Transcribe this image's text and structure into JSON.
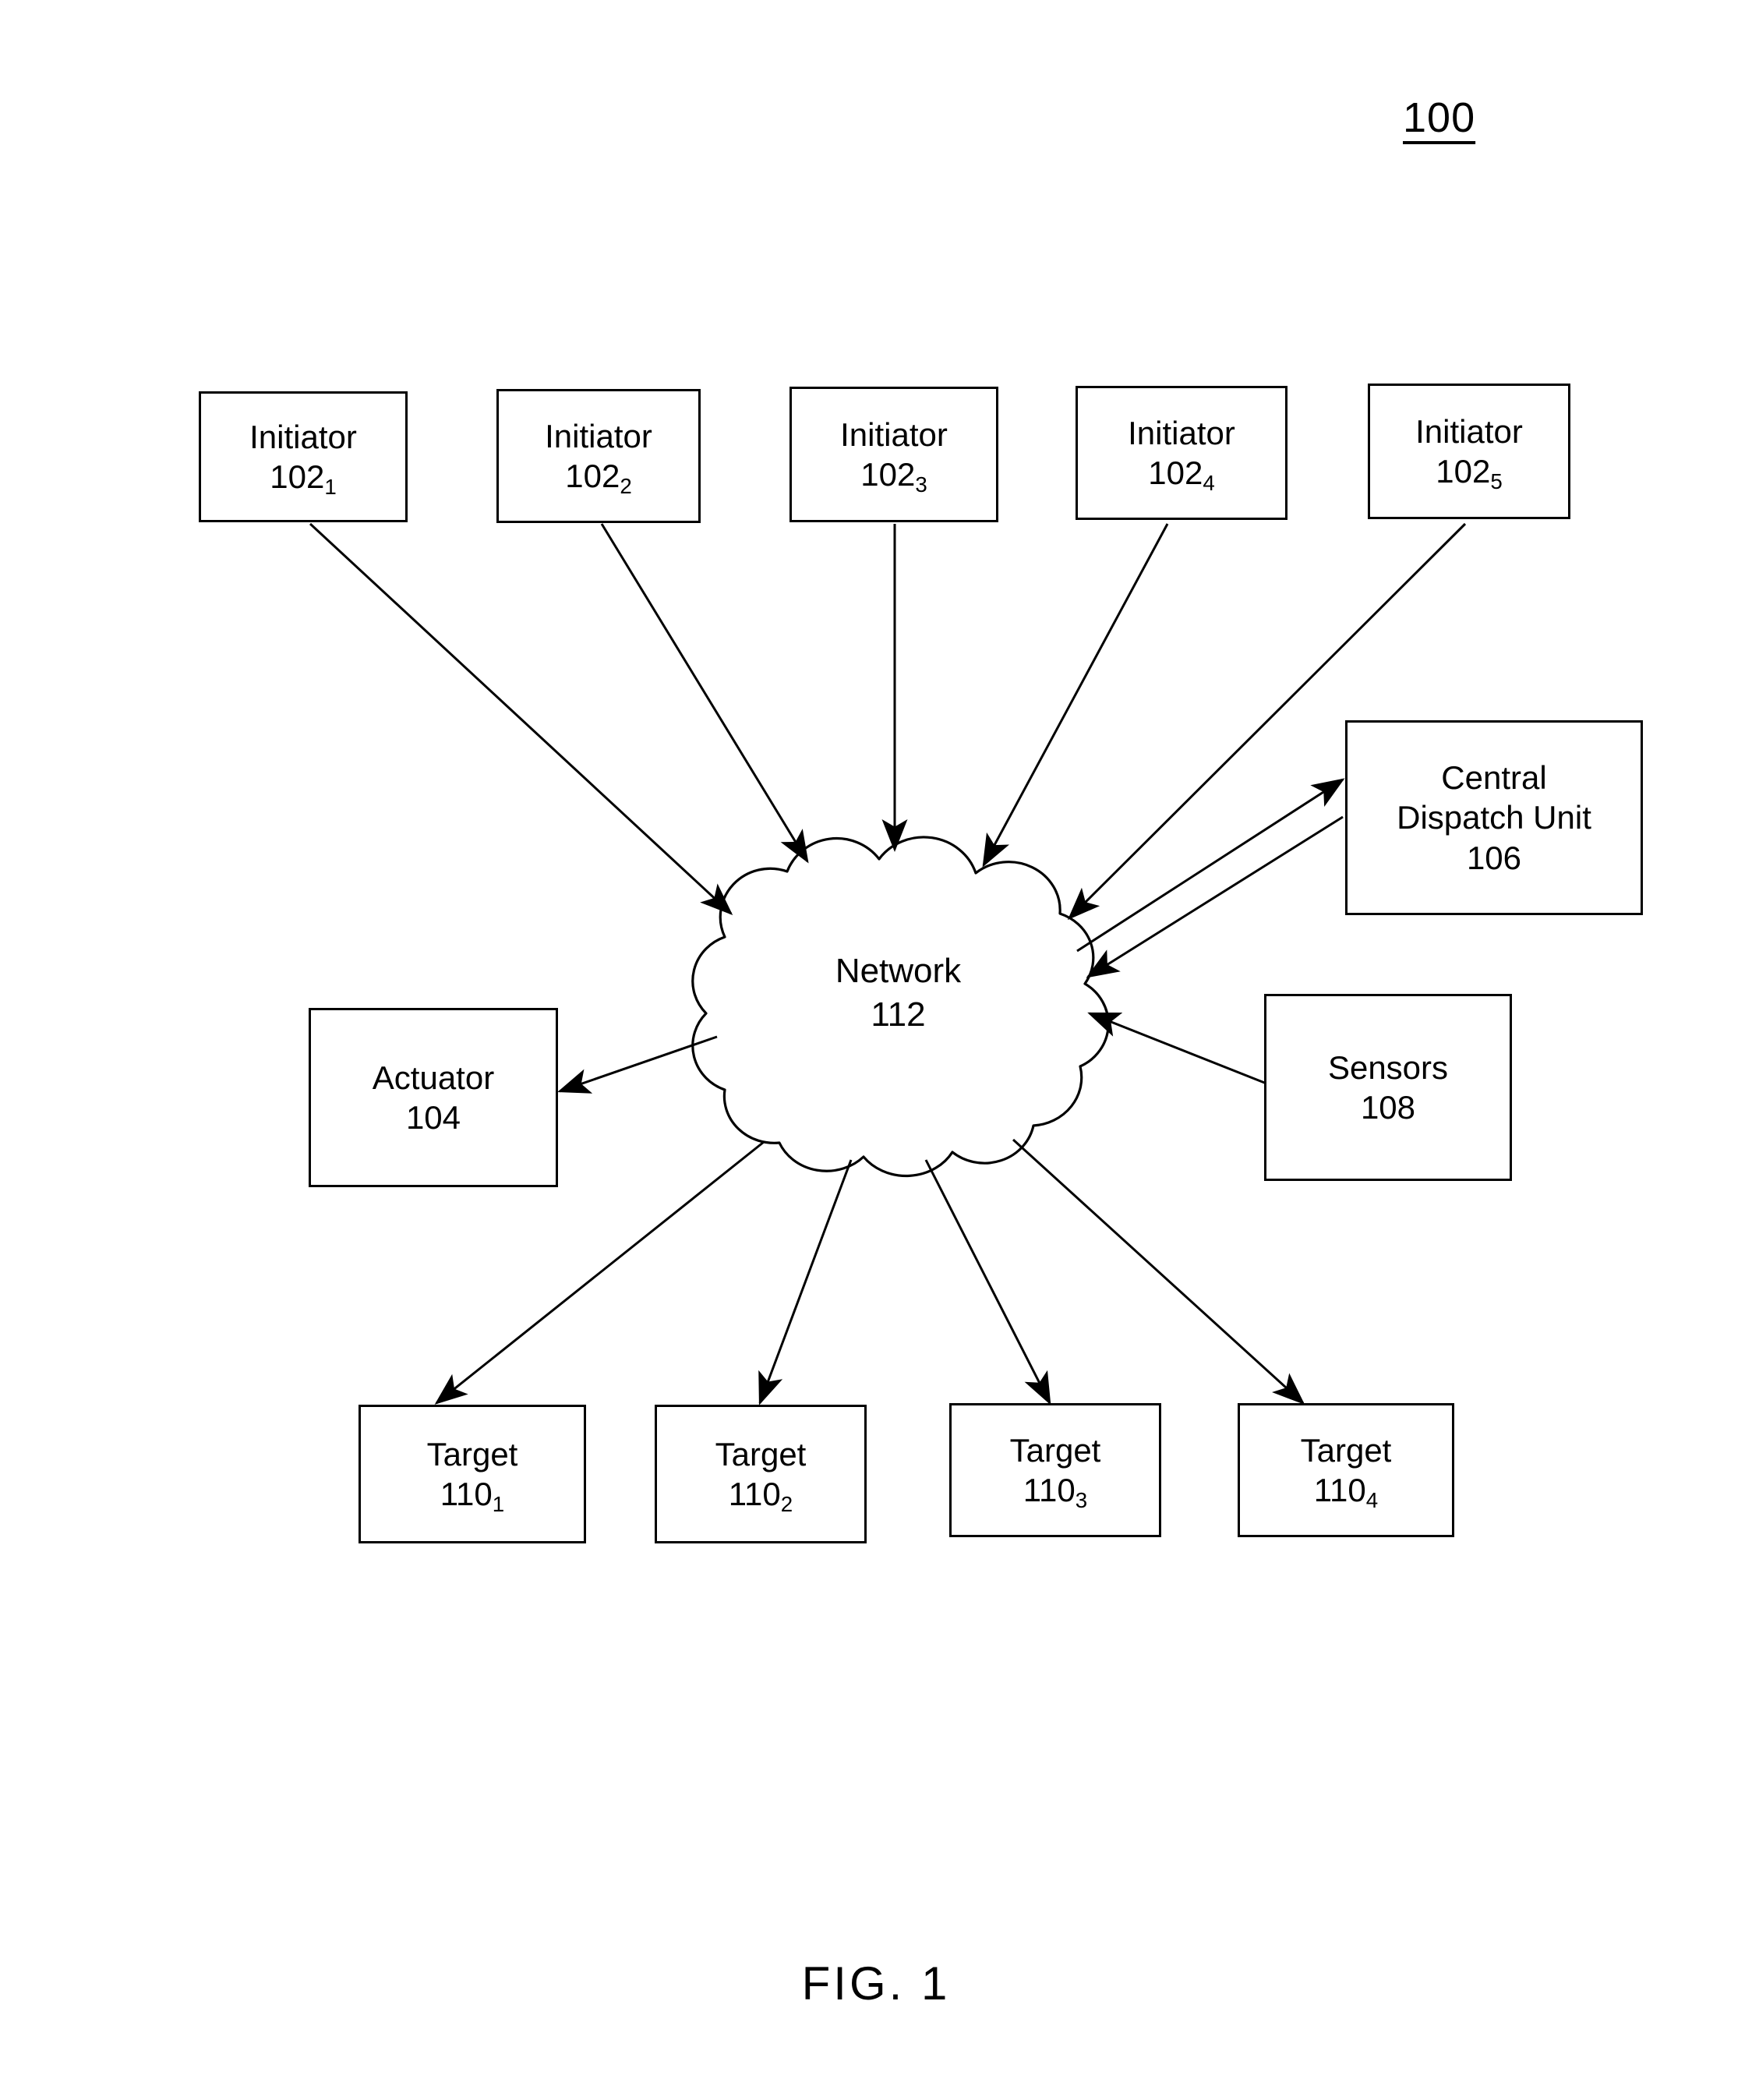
{
  "figure": {
    "reference_numeral": "100",
    "caption": "FIG. 1"
  },
  "nodes": {
    "initiators": [
      {
        "name": "Initiator",
        "ref": "102",
        "sub": "1"
      },
      {
        "name": "Initiator",
        "ref": "102",
        "sub": "2"
      },
      {
        "name": "Initiator",
        "ref": "102",
        "sub": "3"
      },
      {
        "name": "Initiator",
        "ref": "102",
        "sub": "4"
      },
      {
        "name": "Initiator",
        "ref": "102",
        "sub": "5"
      }
    ],
    "targets": [
      {
        "name": "Target",
        "ref": "110",
        "sub": "1"
      },
      {
        "name": "Target",
        "ref": "110",
        "sub": "2"
      },
      {
        "name": "Target",
        "ref": "110",
        "sub": "3"
      },
      {
        "name": "Target",
        "ref": "110",
        "sub": "4"
      }
    ],
    "actuator": {
      "name": "Actuator",
      "ref": "104"
    },
    "sensors": {
      "name": "Sensors",
      "ref": "108"
    },
    "central_dispatch_unit": {
      "name_line1": "Central",
      "name_line2": "Dispatch Unit",
      "ref": "106"
    },
    "network": {
      "name": "Network",
      "ref": "112"
    }
  },
  "colors": {
    "stroke": "#000000",
    "background": "#ffffff"
  }
}
